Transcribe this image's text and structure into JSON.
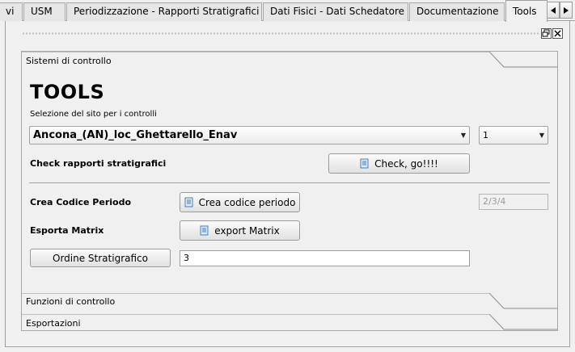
{
  "tabs": [
    {
      "label": "vi"
    },
    {
      "label": "USM"
    },
    {
      "label": "Periodizzazione - Rapporti Stratigrafici"
    },
    {
      "label": "Dati Fisici - Dati Schedatore"
    },
    {
      "label": "Documentazione"
    },
    {
      "label": "Tools"
    }
  ],
  "active_tab": "Tools",
  "toolbox": {
    "sections": [
      {
        "label": "Sistemi di controllo"
      },
      {
        "label": "Funzioni di controllo"
      },
      {
        "label": "Esportazioni"
      }
    ]
  },
  "tools": {
    "title": "TOOLS",
    "site_label": "Selezione del sito per i controlli",
    "site_value": "Ancona_(AN)_loc_Ghettarello_Enav",
    "number_value": "1",
    "check_label": "Check rapporti stratigrafici",
    "check_button": "Check, go!!!!",
    "periodo_label": "Crea Codice Periodo",
    "periodo_button": "Crea codice periodo",
    "periodo_field_placeholder": "2/3/4",
    "matrix_label": "Esporta Matrix",
    "matrix_button": "export Matrix",
    "ordine_button": "Ordine Stratigrafico",
    "ordine_value": "3"
  },
  "icons": {
    "scroll_left": "left-arrow-icon",
    "scroll_right": "right-arrow-icon",
    "float": "float-window-icon",
    "close": "close-icon",
    "document": "document-icon"
  }
}
